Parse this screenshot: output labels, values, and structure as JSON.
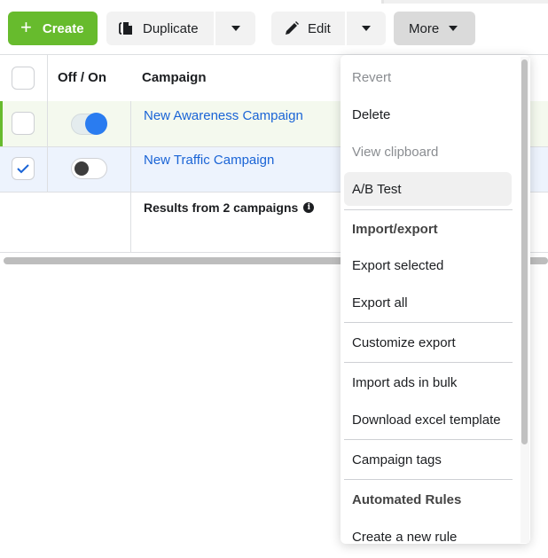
{
  "toolbar": {
    "create_label": "Create",
    "create_icon": "+",
    "duplicate_label": "Duplicate",
    "edit_label": "Edit",
    "more_label": "More"
  },
  "table": {
    "headers": {
      "toggle": "Off / On",
      "campaign": "Campaign"
    },
    "rows": [
      {
        "name": "New Awareness Campaign",
        "status": "on",
        "selected": false
      },
      {
        "name": "New Traffic Campaign",
        "status": "off",
        "selected": true
      }
    ],
    "results_label": "Results from 2 campaigns",
    "info_icon": "i"
  },
  "menu": {
    "items": [
      {
        "label": "Revert",
        "state": "disabled"
      },
      {
        "label": "Delete",
        "state": "normal"
      },
      {
        "label": "View clipboard",
        "state": "disabled"
      },
      {
        "label": "A/B Test",
        "state": "highlighted"
      },
      {
        "label": "Import/export",
        "state": "heading"
      },
      {
        "label": "Export selected",
        "state": "normal"
      },
      {
        "label": "Export all",
        "state": "normal"
      },
      {
        "label": "Customize export",
        "state": "normal"
      },
      {
        "label": "Import ads in bulk",
        "state": "normal"
      },
      {
        "label": "Download excel template",
        "state": "normal"
      },
      {
        "label": "Campaign tags",
        "state": "normal"
      },
      {
        "label": "Automated Rules",
        "state": "heading"
      },
      {
        "label": "Create a new rule",
        "state": "normal"
      }
    ]
  },
  "colors": {
    "create_green": "#67bb2d",
    "link_blue": "#1a64d6",
    "toggle_on_blue": "#2a7cf0",
    "selected_row_bg": "#edf3fd",
    "active_row_bg": "#f4f9ee"
  }
}
